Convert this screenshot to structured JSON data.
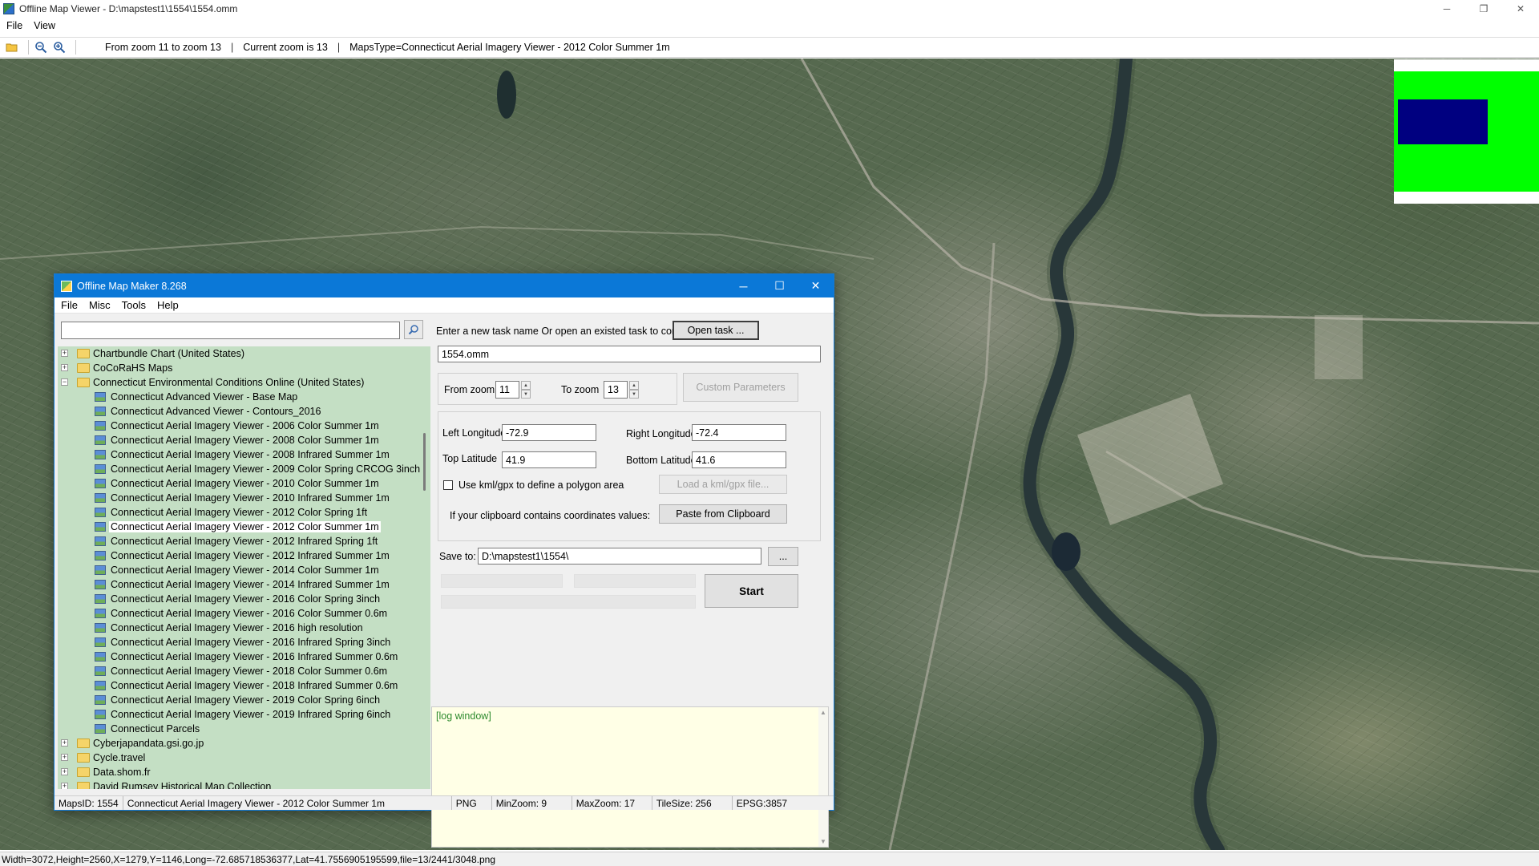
{
  "window": {
    "title": "Offline Map Viewer - D:\\mapstest1\\1554\\1554.omm",
    "controls": [
      "─",
      "❐",
      "✕"
    ]
  },
  "menu": [
    "File",
    "View"
  ],
  "toolbar": {
    "icons": [
      "open-folder-icon",
      "zoom-out-icon",
      "zoom-in-icon"
    ],
    "zoom_range": "From zoom 11 to zoom 13",
    "current_zoom": "Current zoom is 13",
    "maps_type": "MapsType=Connecticut Aerial Imagery Viewer - 2012 Color Summer 1m",
    "pipe": "|"
  },
  "status_bar": "Width=3072,Height=2560,X=1279,Y=1146,Long=-72.685718536377,Lat=41.7556905195599,file=13/2441/3048.png",
  "dialog": {
    "title": "Offline Map Maker 8.268",
    "controls": [
      "─",
      "☐",
      "✕"
    ],
    "menu": [
      "File",
      "Misc",
      "Tools",
      "Help"
    ],
    "search_value": "",
    "tree": [
      {
        "label": "Chartbundle Chart (United States)",
        "type": "folder",
        "level": 0,
        "expander": "+"
      },
      {
        "label": "CoCoRaHS Maps",
        "type": "folder",
        "level": 0,
        "expander": "+"
      },
      {
        "label": "Connecticut Environmental Conditions Online (United States)",
        "type": "folder-open",
        "level": 0,
        "expander": "−"
      },
      {
        "label": "Connecticut Advanced Viewer - Base Map",
        "type": "map",
        "level": 1
      },
      {
        "label": "Connecticut Advanced Viewer - Contours_2016",
        "type": "map",
        "level": 1
      },
      {
        "label": "Connecticut Aerial Imagery Viewer - 2006 Color Summer 1m",
        "type": "map",
        "level": 1
      },
      {
        "label": "Connecticut Aerial Imagery Viewer - 2008 Color Summer 1m",
        "type": "map",
        "level": 1
      },
      {
        "label": "Connecticut Aerial Imagery Viewer - 2008 Infrared Summer 1m",
        "type": "map",
        "level": 1
      },
      {
        "label": "Connecticut Aerial Imagery Viewer - 2009 Color Spring CRCOG 3inch",
        "type": "map",
        "level": 1
      },
      {
        "label": "Connecticut Aerial Imagery Viewer - 2010 Color Summer 1m",
        "type": "map",
        "level": 1
      },
      {
        "label": "Connecticut Aerial Imagery Viewer - 2010 Infrared Summer 1m",
        "type": "map",
        "level": 1
      },
      {
        "label": "Connecticut Aerial Imagery Viewer - 2012 Color Spring 1ft",
        "type": "map",
        "level": 1
      },
      {
        "label": "Connecticut Aerial Imagery Viewer - 2012 Color Summer 1m",
        "type": "map",
        "level": 1,
        "selected": true
      },
      {
        "label": "Connecticut Aerial Imagery Viewer - 2012 Infrared Spring 1ft",
        "type": "map",
        "level": 1
      },
      {
        "label": "Connecticut Aerial Imagery Viewer - 2012 Infrared Summer 1m",
        "type": "map",
        "level": 1
      },
      {
        "label": "Connecticut Aerial Imagery Viewer - 2014 Color Summer 1m",
        "type": "map",
        "level": 1
      },
      {
        "label": "Connecticut Aerial Imagery Viewer - 2014 Infrared Summer 1m",
        "type": "map",
        "level": 1
      },
      {
        "label": "Connecticut Aerial Imagery Viewer - 2016 Color Spring 3inch",
        "type": "map",
        "level": 1
      },
      {
        "label": "Connecticut Aerial Imagery Viewer - 2016 Color Summer 0.6m",
        "type": "map",
        "level": 1
      },
      {
        "label": "Connecticut Aerial Imagery Viewer - 2016 high resolution",
        "type": "map",
        "level": 1
      },
      {
        "label": "Connecticut Aerial Imagery Viewer - 2016 Infrared Spring 3inch",
        "type": "map",
        "level": 1
      },
      {
        "label": "Connecticut Aerial Imagery Viewer - 2016 Infrared Summer 0.6m",
        "type": "map",
        "level": 1
      },
      {
        "label": "Connecticut Aerial Imagery Viewer - 2018 Color Summer 0.6m",
        "type": "map",
        "level": 1
      },
      {
        "label": "Connecticut Aerial Imagery Viewer - 2018 Infrared Summer 0.6m",
        "type": "map",
        "level": 1
      },
      {
        "label": "Connecticut Aerial Imagery Viewer - 2019 Color Spring 6inch",
        "type": "map",
        "level": 1
      },
      {
        "label": "Connecticut Aerial Imagery Viewer - 2019 Infrared Spring 6inch",
        "type": "map",
        "level": 1
      },
      {
        "label": "Connecticut Parcels",
        "type": "map",
        "level": 1
      },
      {
        "label": "Cyberjapandata.gsi.go.jp",
        "type": "folder",
        "level": 0,
        "expander": "+"
      },
      {
        "label": "Cycle.travel",
        "type": "folder",
        "level": 0,
        "expander": "+"
      },
      {
        "label": "Data.shom.fr",
        "type": "folder",
        "level": 0,
        "expander": "+"
      },
      {
        "label": "David Rumsey Historical Map Collection",
        "type": "folder",
        "level": 0,
        "expander": "+"
      }
    ],
    "task": {
      "prompt": "Enter a new task name Or open an existed task to continue:",
      "open_button": "Open task ...",
      "name_value": "1554.omm"
    },
    "zoom": {
      "from_label": "From zoom",
      "from_value": "11",
      "to_label": "To zoom",
      "to_value": "13",
      "custom_button": "Custom Parameters"
    },
    "coords": {
      "left_lon_label": "Left Longitude",
      "left_lon_value": "-72.9",
      "right_lon_label": "Right Longitude",
      "right_lon_value": "-72.4",
      "top_lat_label": "Top Latitude",
      "top_lat_value": "41.9",
      "bottom_lat_label": "Bottom Latitude",
      "bottom_lat_value": "41.6",
      "kml_label": "Use kml/gpx to define a polygon area",
      "kml_button": "Load a kml/gpx file...",
      "clipboard_label": "If your clipboard contains coordinates values:",
      "clipboard_button": "Paste from Clipboard"
    },
    "save": {
      "label": "Save to:",
      "value": "D:\\mapstest1\\1554\\",
      "browse_button": "...",
      "start_button": "Start"
    },
    "log_text": "[log window]",
    "status": {
      "maps_id": "MapsID: 1554",
      "map_name": "Connecticut Aerial Imagery Viewer - 2012 Color Summer 1m",
      "format": "PNG",
      "min_zoom": "MinZoom: 9",
      "max_zoom": "MaxZoom: 17",
      "tile_size": "TileSize: 256",
      "epsg": "EPSG:3857"
    }
  },
  "colors": {
    "dialog_title_bg": "#0b78d7",
    "tree_bg": "#c4dfc4",
    "log_bg": "#ffffe6",
    "overview_green": "#00ff00",
    "overview_viewport": "#000080"
  }
}
